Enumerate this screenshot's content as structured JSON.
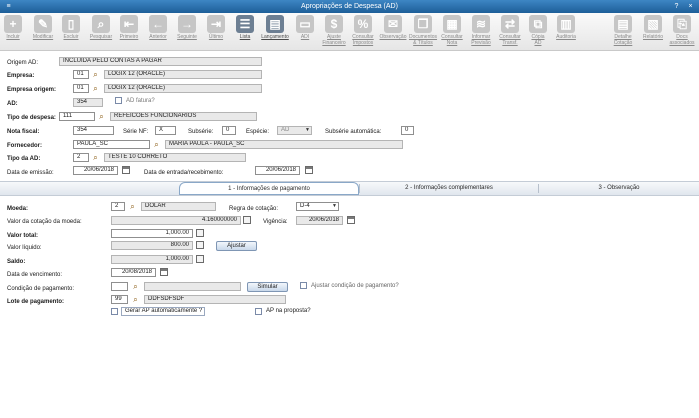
{
  "window": {
    "title": "Apropriações de Despesa (AD)"
  },
  "toolbar": [
    {
      "label": "Incluir",
      "enabled": false
    },
    {
      "label": "Modificar",
      "enabled": false
    },
    {
      "label": "Excluir",
      "enabled": false
    },
    {
      "label": "Pesquisar",
      "enabled": false
    },
    {
      "label": "Primeiro",
      "enabled": false
    },
    {
      "label": "Anterior",
      "enabled": false
    },
    {
      "label": "Seguinte",
      "enabled": false
    },
    {
      "label": "Último",
      "enabled": false
    },
    {
      "label": "Lista",
      "enabled": true
    },
    {
      "label": "Lançamento",
      "enabled": true
    },
    {
      "label": "ADI",
      "enabled": false
    },
    {
      "label": "Ajuste\nFinanceiro",
      "enabled": false
    },
    {
      "label": "Consultar\nImpostos",
      "enabled": false
    },
    {
      "label": "Observação",
      "enabled": false
    },
    {
      "label": "Documentos\n& Títulos",
      "enabled": false
    },
    {
      "label": "Consultar\nNota",
      "enabled": false
    },
    {
      "label": "Informar\nPrevisão",
      "enabled": false
    },
    {
      "label": "Consultar\nTransf.",
      "enabled": false
    },
    {
      "label": "Cópia\nAD",
      "enabled": false
    },
    {
      "label": "Auditoria",
      "enabled": false
    },
    {
      "label": "Detalhe\nCotação",
      "enabled": false
    },
    {
      "label": "Relatório",
      "enabled": false
    },
    {
      "label": "Docs\nassociados",
      "enabled": false
    }
  ],
  "header": {
    "origem_label": "Origem AD:",
    "origem_value": "INCLUÍDA PELO CONTAS A PAGAR",
    "empresa_label": "Empresa:",
    "empresa_code": "01",
    "empresa_name": "LOGIX 12 (ORACLE)",
    "empresa_origem_label": "Empresa origem:",
    "empresa_origem_code": "01",
    "empresa_origem_name": "LOGIX 12 (ORACLE)",
    "ad_label": "AD:",
    "ad_value": "354",
    "ad_fatura_label": "AD fatura?",
    "tipo_despesa_label": "Tipo de despesa:",
    "tipo_despesa_code": "111",
    "tipo_despesa_name": "REFEICOES FUNCIONARIOS",
    "nota_fiscal_label": "Nota fiscal:",
    "nota_fiscal_value": "354",
    "serie_nf_label": "Série NF:",
    "serie_nf_value": "X",
    "subserie_label": "Subsérie:",
    "subserie_value": "0",
    "especie_label": "Espécie:",
    "especie_value": "AD",
    "subserie_auto_label": "Subsérie automática:",
    "subserie_auto_value": "0",
    "fornecedor_label": "Fornecedor:",
    "fornecedor_code": "PAULA_SC",
    "fornecedor_name": "MARIA PAULA - PAULA_SC",
    "tipo_ad_label": "Tipo da AD:",
    "tipo_ad_code": "2",
    "tipo_ad_name": "TESTE 10 CORRETO",
    "data_emissao_label": "Data de emissão:",
    "data_emissao_value": "20/06/2018",
    "data_entrada_label": "Data de entrada/recebimento:",
    "data_entrada_value": "20/06/2018"
  },
  "tabs": [
    {
      "label": "1 - Informações de pagamento",
      "active": true
    },
    {
      "label": "2 - Informações complementares",
      "active": false
    },
    {
      "label": "3 - Observação",
      "active": false
    }
  ],
  "payment": {
    "moeda_label": "Moeda:",
    "moeda_code": "2",
    "moeda_name": "DOLAR",
    "regra_label": "Regra de cotação:",
    "regra_value": "D-4",
    "valor_cotacao_label": "Valor da cotação da moeda:",
    "valor_cotacao_value": "4.160000000",
    "vigencia_label": "Vigência:",
    "vigencia_value": "20/06/2018",
    "valor_total_label": "Valor total:",
    "valor_total_value": "1,000.00",
    "valor_liquido_label": "Valor líquido:",
    "valor_liquido_value": "800.00",
    "ajustar_label": "Ajustar",
    "saldo_label": "Saldo:",
    "saldo_value": "1,000.00",
    "data_venc_label": "Data de vencimento:",
    "data_venc_value": "20/08/2018",
    "condicao_label": "Condição de pagamento:",
    "condicao_code": "",
    "condicao_name": "",
    "simular_label": "Simular",
    "ajustar_cond_label": "Ajustar condição de pagamento?",
    "lote_label": "Lote de pagamento:",
    "lote_code": "99",
    "lote_name": "DDFSDFSDF",
    "gerar_ap_label": "Gerar AP automaticamente ?",
    "ap_proposta_label": "AP na proposta?"
  }
}
